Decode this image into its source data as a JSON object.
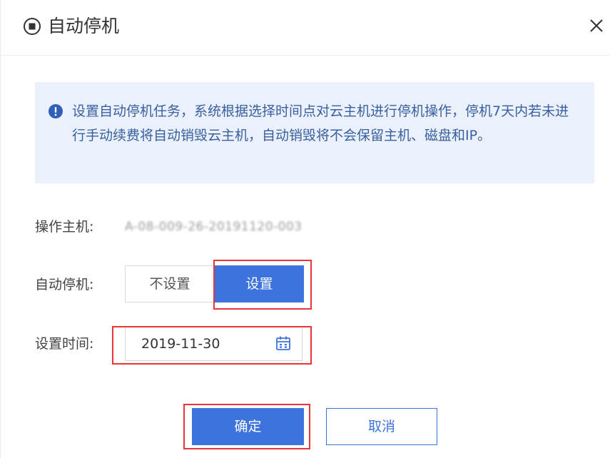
{
  "dialog": {
    "title": "自动停机",
    "title_icon": "stop-circle-icon",
    "close_icon": "close-icon"
  },
  "notice": {
    "icon": "info-circle-icon",
    "text": "设置自动停机任务，系统根据选择时间点对云主机进行停机操作，停机7天内若未进行手动续费将自动销毁云主机，自动销毁将不会保留主机、磁盘和IP。"
  },
  "form": {
    "host_label": "操作主机:",
    "host_value": "A-08-009-26-20191120-003",
    "auto_stop_label": "自动停机:",
    "auto_stop_options": [
      "不设置",
      "设置"
    ],
    "auto_stop_selected": "设置",
    "time_label": "设置时间:",
    "time_value": "2019-11-30",
    "calendar_icon": "calendar-icon"
  },
  "actions": {
    "confirm_label": "确定",
    "cancel_label": "取消"
  },
  "colors": {
    "primary": "#3d73dd",
    "notice_bg": "#eaf1fd",
    "notice_text": "#3a5f9e",
    "highlight": "#e8353a"
  }
}
